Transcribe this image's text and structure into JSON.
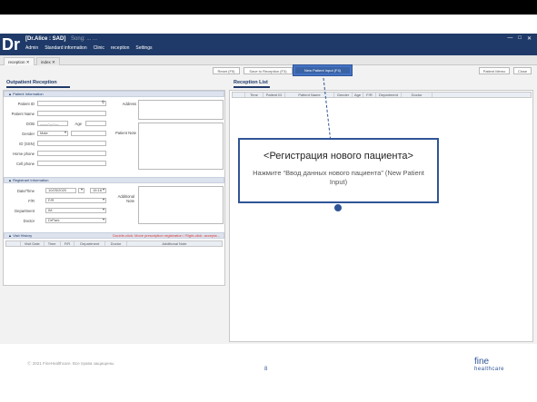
{
  "app": {
    "logo": "Dr",
    "doctor": "[Dr.Alice : SAD]",
    "header_extra": "Song: ...  ...",
    "menu": [
      "Admin",
      "Standard information",
      "Clinic",
      "reception",
      "Settings"
    ],
    "window_controls": [
      "—",
      "□",
      "✕"
    ]
  },
  "tabs": [
    {
      "label": "reception ✕"
    },
    {
      "label": "index ✕"
    }
  ],
  "toolbar": {
    "buttons": [
      "Reset (F5)",
      "Save to Reception (F3)",
      "New Patient Input (F4)",
      "Patient Memo",
      "Close"
    ],
    "hint": "Double-click: Move prescription / registration / Right-click: Acceptable cha..."
  },
  "outpatient": {
    "title": "Outpatient Reception",
    "patient_info": "▲ Patient Information",
    "labels": [
      "Patient ID",
      "Patient Name",
      "DOB",
      "Gender",
      "ID (SSN)",
      "Home phone",
      "Cell phone"
    ],
    "age_label": "Age",
    "dob_placeholder": "____-__-__",
    "gender_value": "Male",
    "address_label": "Address",
    "patient_note_label": "Patient Note",
    "registrant_info": "▲ Registrant Information",
    "reg_labels": [
      "Date/Time",
      "F/R",
      "Department",
      "Doctor"
    ],
    "date_value": "10/25/2020",
    "time_value": "15:18",
    "fr_value": "F/R",
    "department_value": "IM",
    "doctor_value": "DrPark",
    "additional_note_label": "Additional Note",
    "visit_history": "▲ Visit History",
    "visit_hint": "Double-click: Move prescription registration / Right-click: accepta...",
    "visit_columns": [
      "Visit Date",
      "Time",
      "F/R",
      "Department",
      "Doctor",
      "Additional Note"
    ]
  },
  "reception_list": {
    "title": "Reception List",
    "columns": [
      "",
      "Time",
      "Patient ID",
      "Patient Name",
      "Gender",
      "Age",
      "F/R",
      "Department",
      "Doctor"
    ]
  },
  "callout": {
    "title": "<Регистрация нового пациента>",
    "desc": "Нажмите “Ввод данных нового пациента” (New Patient Input)"
  },
  "footer": {
    "copyright": "Ⓒ 2021 FineHealthcare. Все права защищены.",
    "page": "8",
    "brand_top": "fine",
    "brand_bottom": "healthcare"
  },
  "colors": {
    "accent": "#1f3a68",
    "highlight": "#4472c4",
    "hint": "#dd3333"
  }
}
